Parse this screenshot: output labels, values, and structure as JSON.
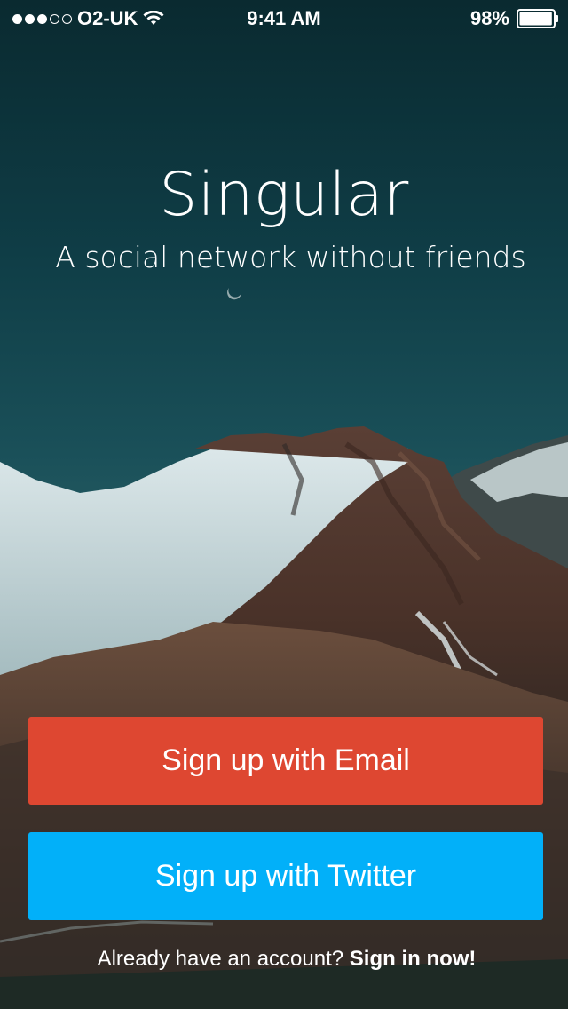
{
  "status_bar": {
    "signal_bars_filled": 3,
    "signal_bars_total": 5,
    "carrier": "O2-UK",
    "time": "9:41 AM",
    "battery_percent_label": "98%",
    "battery_level": 0.98,
    "icons": [
      "signal-icon",
      "wifi-icon",
      "battery-icon"
    ]
  },
  "hero": {
    "app_title": "Singular",
    "tagline": "A social network without friends"
  },
  "actions": {
    "email_button_label": "Sign up with Email",
    "twitter_button_label": "Sign up with Twitter",
    "signin_prompt": "Already have an account?",
    "signin_link": "Sign in now!"
  },
  "colors": {
    "email_button": "#de4731",
    "twitter_button": "#02b0f9",
    "sky": "#0f3b44",
    "text": "#ffffff"
  }
}
